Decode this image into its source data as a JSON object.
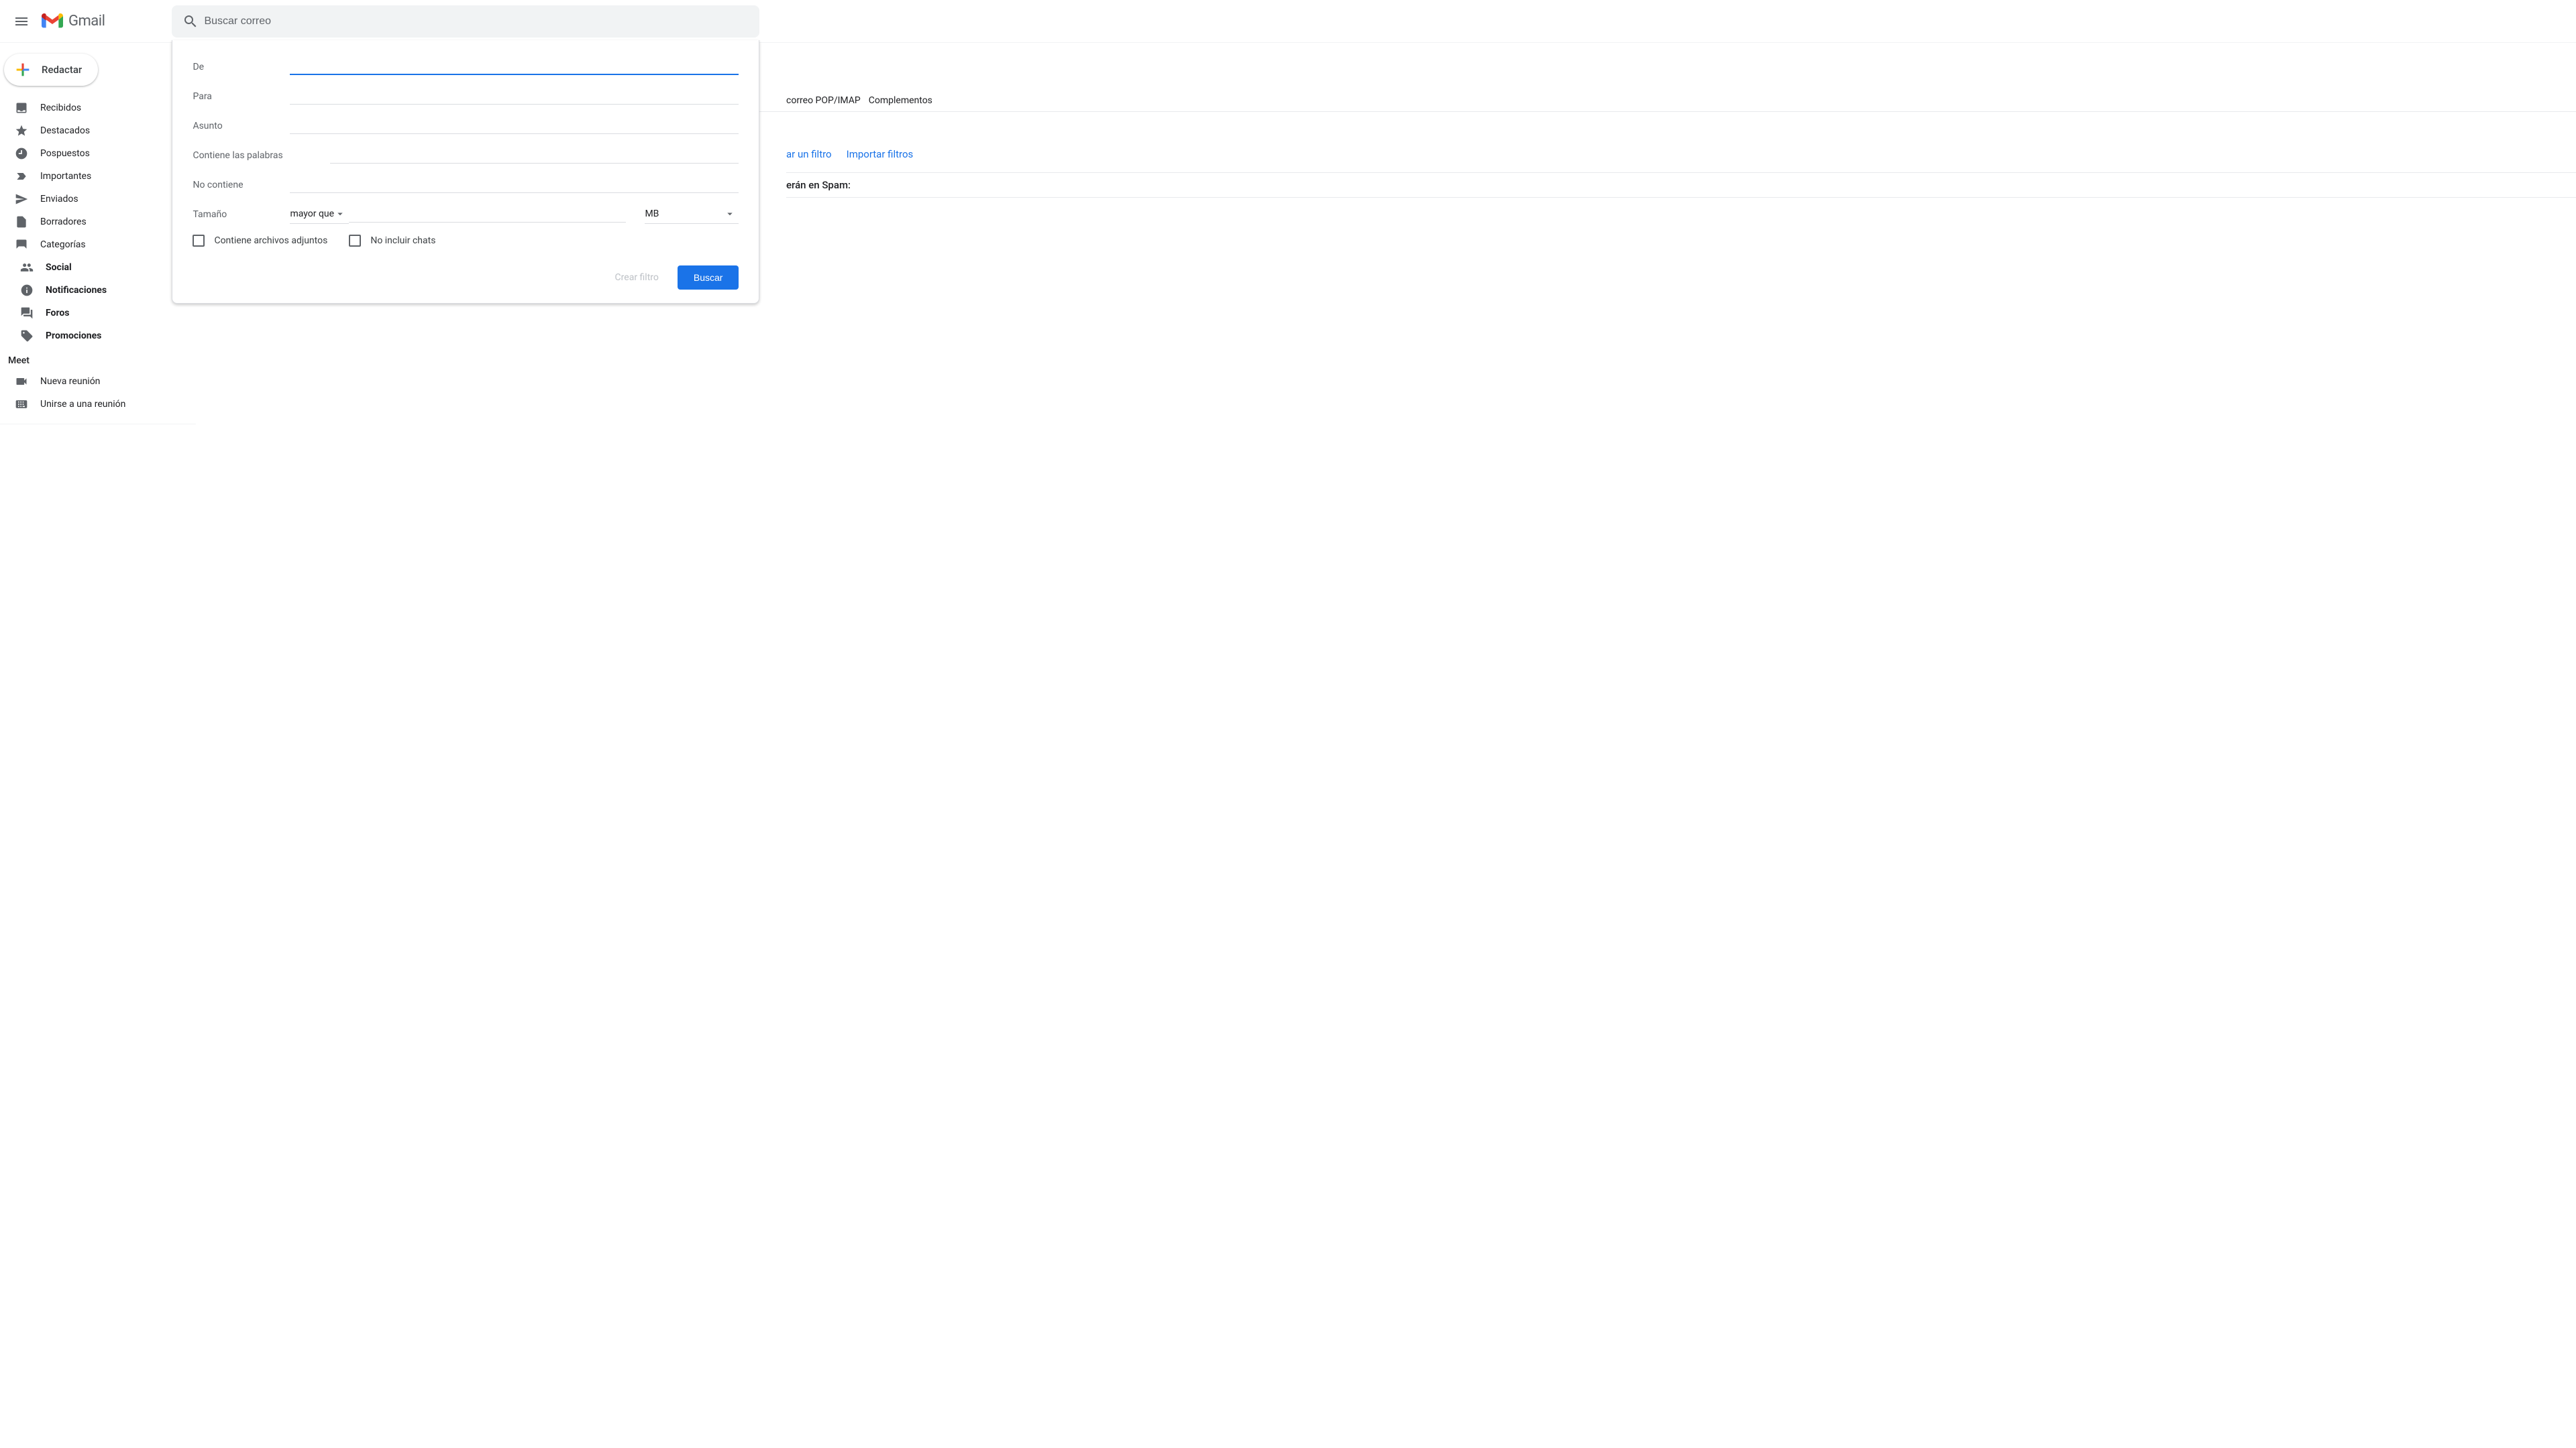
{
  "header": {
    "brand": "Gmail",
    "search_placeholder": "Buscar correo"
  },
  "compose": {
    "label": "Redactar"
  },
  "sidebar": {
    "items": [
      {
        "label": "Recibidos"
      },
      {
        "label": "Destacados"
      },
      {
        "label": "Pospuestos"
      },
      {
        "label": "Importantes"
      },
      {
        "label": "Enviados"
      },
      {
        "label": "Borradores"
      },
      {
        "label": "Categorías"
      }
    ],
    "categories": [
      {
        "label": "Social"
      },
      {
        "label": "Notificaciones"
      },
      {
        "label": "Foros"
      },
      {
        "label": "Promociones"
      }
    ],
    "meet_label": "Meet",
    "meet": [
      {
        "label": "Nueva reunión"
      },
      {
        "label": "Unirse a una reunión"
      }
    ]
  },
  "filter": {
    "from": "De",
    "to": "Para",
    "subject": "Asunto",
    "has_words": "Contiene las palabras",
    "not_has": "No contiene",
    "size": "Tamaño",
    "size_op": "mayor que",
    "size_unit": "MB",
    "has_attach": "Contiene archivos adjuntos",
    "no_chats": "No incluir chats",
    "create_filter": "Crear filtro",
    "search": "Buscar"
  },
  "settings": {
    "tab_pop": "correo POP/IMAP",
    "tab_addons": "Complementos",
    "link_create": "ar un filtro",
    "link_import": "Importar filtros",
    "spam_hint": "erán en Spam:"
  }
}
